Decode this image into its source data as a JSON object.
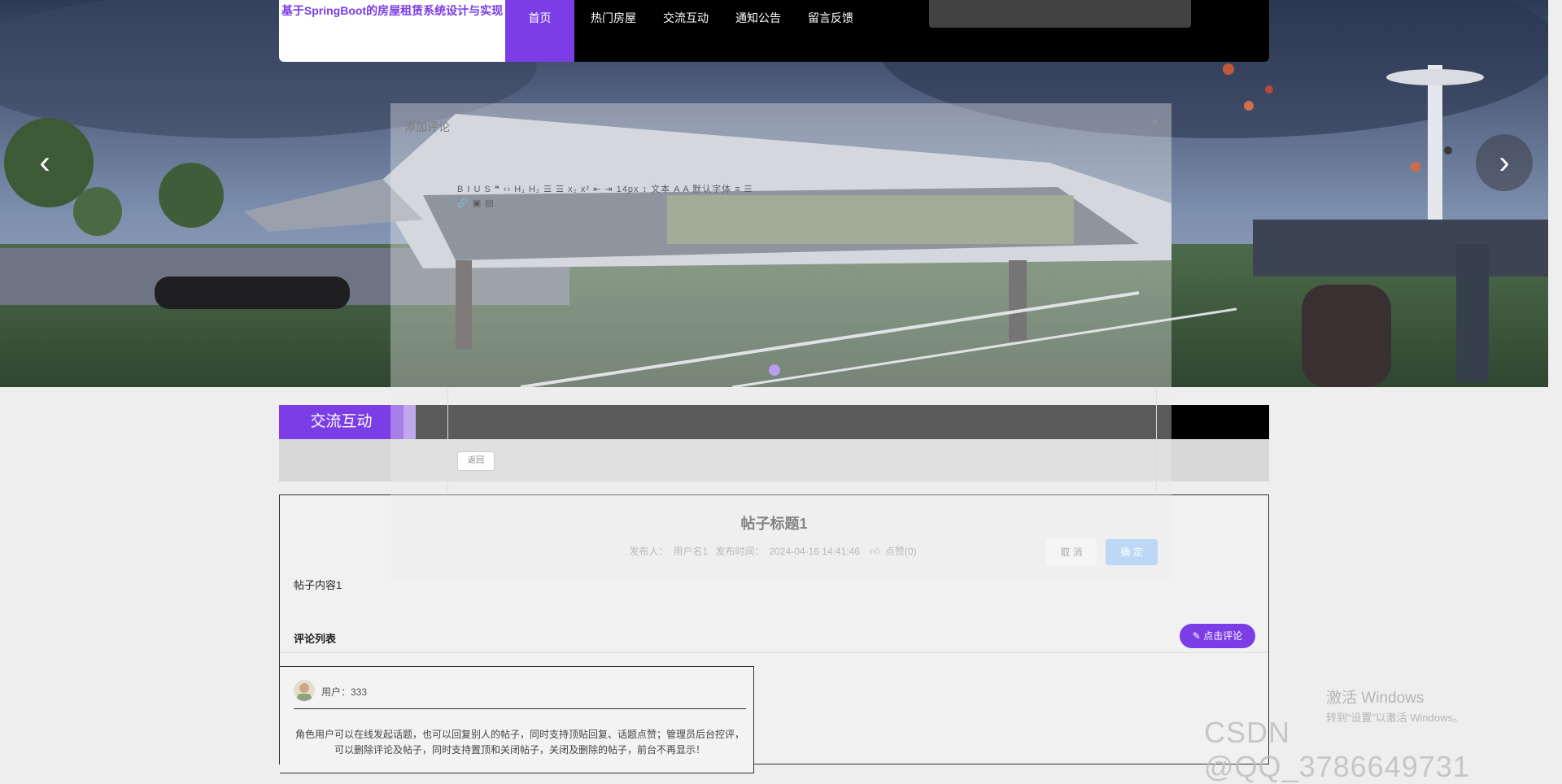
{
  "site": {
    "brand": "基于SpringBoot的房屋租赁系统设计与实现",
    "nav": [
      "首页",
      "热门房屋",
      "交流互动",
      "通知公告",
      "留言反馈"
    ],
    "active_nav": "首页"
  },
  "section": {
    "title": "交流互动"
  },
  "post": {
    "title": "帖子标题1",
    "publisher_label": "发布人：",
    "publisher": "用户名1",
    "time_label": "发布时间：",
    "time": "2024-04-16 14:41:46",
    "likes": "点赞(0)",
    "content": "帖子内容1",
    "comments_heading": "评论列表",
    "comment_button": "点击评论"
  },
  "comments": [
    {
      "user": "用户：333",
      "text": "角色用户可以在线发起话题，也可以回复别人的帖子，同时支持顶贴回复、话题点赞；管理员后台控评，可以删除评论及帖子，同时支持置顶和关闭帖子，关闭及删除的帖子，前台不再显示！"
    }
  ],
  "modal": {
    "title": "添加评论",
    "close": "×",
    "toolbar_row1": "B  I  U  S   ❝  ‹›   H₁ H₂   ☰  ☰   x₂ x²   ⇤ ⇥   14px   ↕   文本   A   A   默认字体   ≡   ☰",
    "toolbar_row2": "🔗  ▣  ▤",
    "back": "返回",
    "cancel": "取 消",
    "confirm": "确 定"
  },
  "watermarks": {
    "windows_line1": "激活 Windows",
    "windows_line2": "转到“设置”以激活 Windows。",
    "csdn": "CSDN @QQ_3786649731"
  },
  "colors": {
    "accent": "#7b3de6",
    "navbar": "#000000"
  },
  "icons": [
    "chevron-left-icon",
    "chevron-right-icon",
    "thumbs-up-icon",
    "edit-icon",
    "close-icon"
  ]
}
